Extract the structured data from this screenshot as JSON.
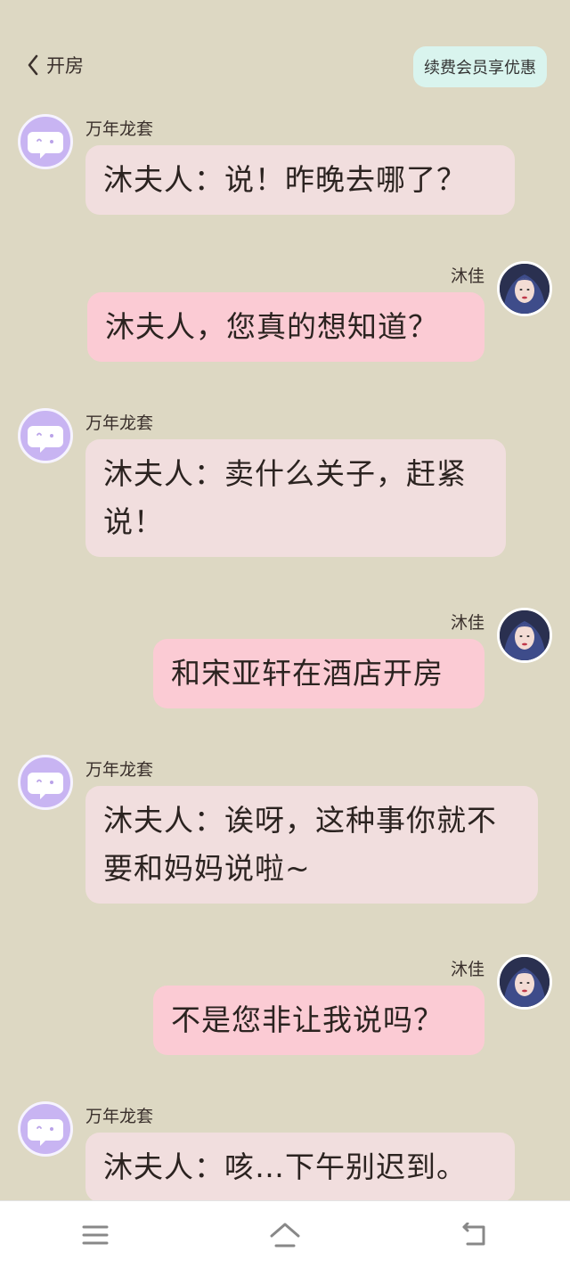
{
  "header": {
    "back_label": "开房",
    "vip_label": "续费会员享优惠"
  },
  "messages": [
    {
      "sender": "万年龙套",
      "text": "沐夫人：说！昨晚去哪了？"
    },
    {
      "sender": "沐佳",
      "text": "沐夫人，您真的想知道？"
    },
    {
      "sender": "万年龙套",
      "text": "沐夫人：卖什么关子，赶紧说！"
    },
    {
      "sender": "沐佳",
      "text": "和宋亚轩在酒店开房"
    },
    {
      "sender": "万年龙套",
      "text": "沐夫人：诶呀，这种事你就不要和妈妈说啦~"
    },
    {
      "sender": "沐佳",
      "text": "不是您非让我说吗？"
    },
    {
      "sender": "万年龙套",
      "text": "沐夫人：咳…下午别迟到。"
    }
  ],
  "navbar": {
    "icons": [
      "menu-icon",
      "home-icon",
      "back-icon"
    ]
  },
  "colors": {
    "background": "#ddd8c3",
    "bot_bubble": "#f1dede",
    "user_bubble": "#fbcbd4",
    "vip_button": "#d9f4ee",
    "bot_avatar": "#c8b4f2"
  }
}
